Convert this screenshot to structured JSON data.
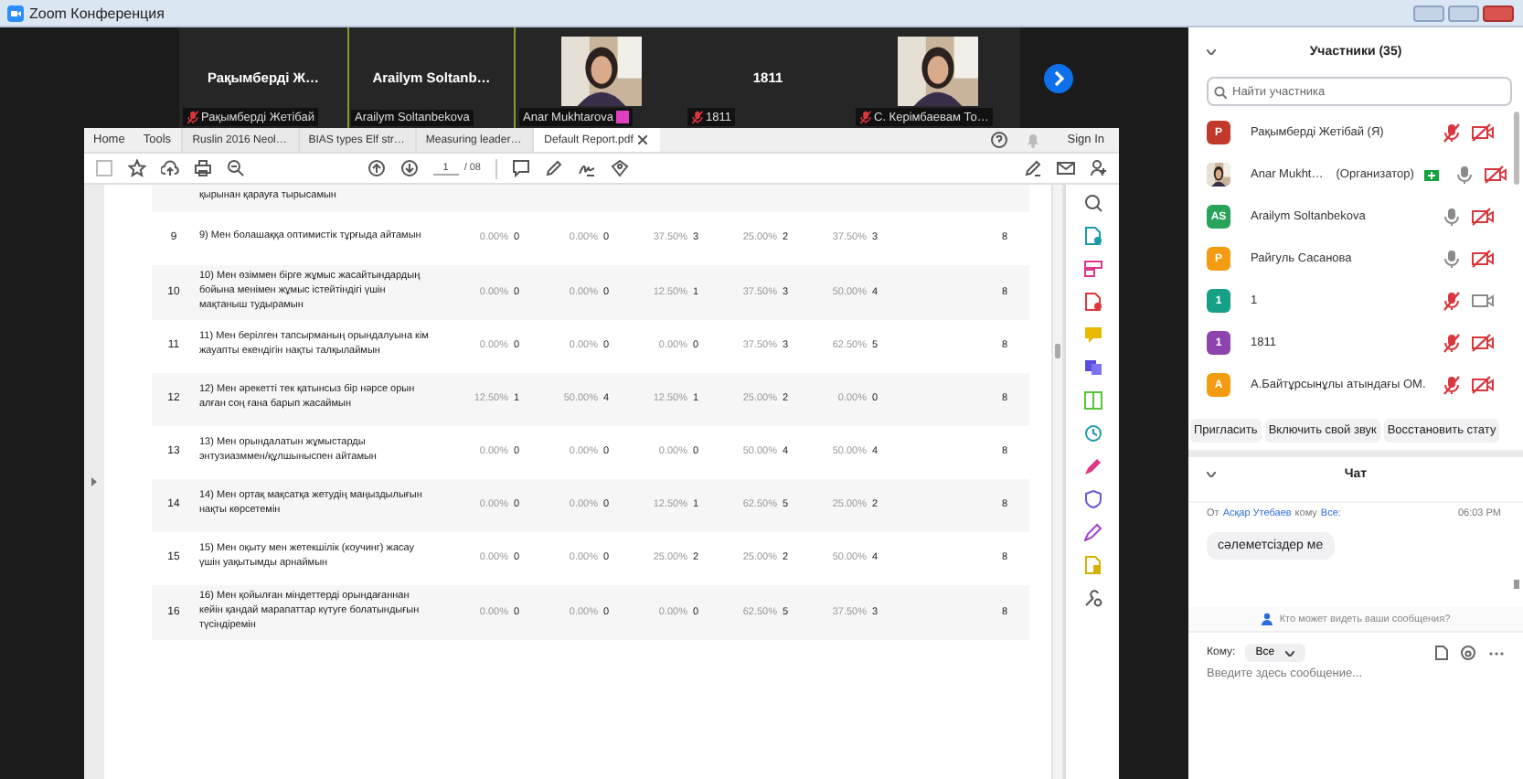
{
  "window": {
    "title": "Zoom Конференция"
  },
  "video_tiles": [
    {
      "kind": "name",
      "display": "Рақымберді Ж…",
      "label": "Рақымберді Жетібай",
      "muted": true,
      "speaking": false,
      "badge": false
    },
    {
      "kind": "name",
      "display": "Arailym  Soltanb…",
      "label": "Arailym Soltanbekova",
      "muted": false,
      "speaking": true,
      "badge": false
    },
    {
      "kind": "video",
      "label": "Anar Mukhtarova",
      "muted": false,
      "speaking": false,
      "badge": true
    },
    {
      "kind": "name",
      "display": "1811",
      "label": "1811",
      "muted": true,
      "speaking": false,
      "badge": false
    },
    {
      "kind": "video",
      "label": "С. Керімбаевам То…",
      "muted": true,
      "speaking": false,
      "badge": false
    }
  ],
  "pdf": {
    "tabs": [
      {
        "label": "Home",
        "kind": "nav",
        "selected": false
      },
      {
        "label": "Tools",
        "kind": "nav",
        "selected": false
      },
      {
        "label": "Ruslin 2016 Neol…",
        "kind": "doc",
        "selected": false
      },
      {
        "label": "BIAS types Elf str…",
        "kind": "doc",
        "selected": false
      },
      {
        "label": "Measuring leader…",
        "kind": "doc",
        "selected": false
      },
      {
        "label": "Default Report.pdf",
        "kind": "doc",
        "selected": true
      }
    ],
    "sign_in": "Sign In",
    "page": "1",
    "page_total": "/ 08",
    "partial_row": "қырынан қарауға тырысамын",
    "rows": [
      {
        "num": "9",
        "text": "9) Мен болашаққа оптимистік тұрғыда айтамын",
        "cells": [
          "0.00%",
          "0",
          "0.00%",
          "0",
          "37.50%",
          "3",
          "25.00%",
          "2",
          "37.50%",
          "3"
        ],
        "total": "8"
      },
      {
        "num": "10",
        "text": "10) Мен өзіммен бірге жұмыс жасайтындардың бойына менімен жұмыс істейтіндігі үшін мақтаныш тудырамын",
        "cells": [
          "0.00%",
          "0",
          "0.00%",
          "0",
          "12.50%",
          "1",
          "37.50%",
          "3",
          "50.00%",
          "4"
        ],
        "total": "8"
      },
      {
        "num": "11",
        "text": "11) Мен берілген тапсырманың орындалуына кім жауапты екендігін нақты талқылаймын",
        "cells": [
          "0.00%",
          "0",
          "0.00%",
          "0",
          "0.00%",
          "0",
          "37.50%",
          "3",
          "62.50%",
          "5"
        ],
        "total": "8"
      },
      {
        "num": "12",
        "text": "12) Мен әрекетті тек қатынсыз бір нәрсе орын алған соң ғана барып жасаймын",
        "cells": [
          "12.50%",
          "1",
          "50.00%",
          "4",
          "12.50%",
          "1",
          "25.00%",
          "2",
          "0.00%",
          "0"
        ],
        "total": "8"
      },
      {
        "num": "13",
        "text": "13) Мен орындалатын жұмыстарды энтузиазммен/құлшыныспен айтамын",
        "cells": [
          "0.00%",
          "0",
          "0.00%",
          "0",
          "0.00%",
          "0",
          "50.00%",
          "4",
          "50.00%",
          "4"
        ],
        "total": "8"
      },
      {
        "num": "14",
        "text": "14) Мен ортақ мақсатқа жетудің маңыздылығын нақты көрсетемін",
        "cells": [
          "0.00%",
          "0",
          "0.00%",
          "0",
          "12.50%",
          "1",
          "62.50%",
          "5",
          "25.00%",
          "2"
        ],
        "total": "8"
      },
      {
        "num": "15",
        "text": "15) Мен оқыту мен жетекшілік (коучинг) жасау үшін уақытымды арнаймын",
        "cells": [
          "0.00%",
          "0",
          "0.00%",
          "0",
          "25.00%",
          "2",
          "25.00%",
          "2",
          "50.00%",
          "4"
        ],
        "total": "8"
      },
      {
        "num": "16",
        "text": "16) Мен қойылған міндеттерді орындағаннан кейін қандай марапаттар күтуге болатындығын түсіндіремін",
        "cells": [
          "0.00%",
          "0",
          "0.00%",
          "0",
          "0.00%",
          "0",
          "62.50%",
          "5",
          "37.50%",
          "3"
        ],
        "total": "8"
      }
    ]
  },
  "participants": {
    "title": "Участники (35)",
    "search": {
      "placeholder": "Найти участника"
    },
    "items": [
      {
        "kind": "letter",
        "initials": "Р",
        "color": "#c0392b",
        "name": "Рақымберді Жетібай (Я)",
        "mic_muted": true,
        "video_off": true
      },
      {
        "name": "Anar Mukht…",
        "role": "(Организатор)",
        "mic_muted": false,
        "video_off": true
      },
      {
        "kind": "letter",
        "initials": "AS",
        "color": "#27a35a",
        "name": "Arailym Soltanbekova",
        "mic_muted": false,
        "video_off": true
      },
      {
        "kind": "letter",
        "initials": "Р",
        "color": "#f39c12",
        "name": "Райгуль Сасанова",
        "mic_muted": false,
        "video_off": true
      },
      {
        "kind": "letter",
        "initials": "1",
        "color": "#16a085",
        "name": "1",
        "mic_muted": true,
        "video_off": false
      },
      {
        "kind": "letter",
        "initials": "1",
        "color": "#8e44ad",
        "name": "1811",
        "mic_muted": true,
        "video_off": true
      },
      {
        "kind": "letter",
        "initials": "А",
        "color": "#f39c12",
        "name": "А.Байтұрсынұлы атындағы ОМ.",
        "mic_muted": true,
        "video_off": true
      }
    ],
    "buttons": [
      "Пригласить",
      "Включить свой звук",
      "Восстановить стату"
    ]
  },
  "chat": {
    "title": "Чат",
    "from_prefix": "От",
    "sender": "Асқар Утебаев",
    "to_word": "кому",
    "to_name": "Все:",
    "time": "06:03 PM",
    "message": "сәлеметсіздер ме",
    "visibility": "Кто может видеть ваши сообщения?",
    "to_label": "Кому:",
    "recipient": "Все",
    "input": {
      "placeholder": "Введите здесь сообщение..."
    }
  }
}
